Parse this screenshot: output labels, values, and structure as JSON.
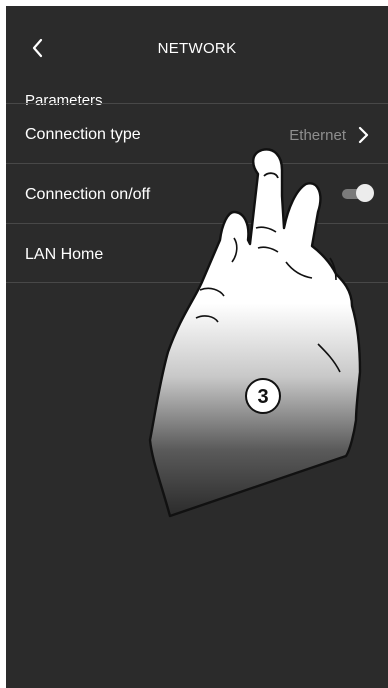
{
  "header": {
    "back_icon": "chevron-left-icon",
    "title": "NETWORK"
  },
  "section": {
    "label": "Parameters"
  },
  "rows": [
    {
      "label": "Connection type",
      "value": "Ethernet",
      "icon": "chevron-right-icon"
    },
    {
      "label": "Connection on/off",
      "toggle_on": true
    },
    {
      "label": "LAN Home"
    }
  ],
  "overlay": {
    "illustration": "pointing-hand-icon",
    "step_number": "3"
  },
  "colors": {
    "background": "#2b2b2b",
    "divider": "#484848",
    "text": "#ffffff",
    "value_text": "#8e8e8e",
    "toggle_track": "#7b7b7b",
    "toggle_knob": "#ececec"
  }
}
